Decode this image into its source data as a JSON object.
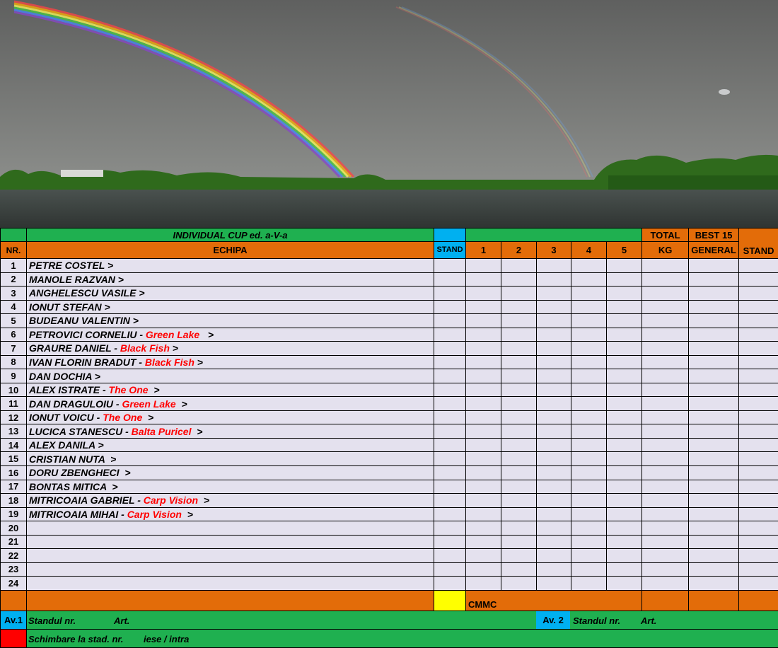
{
  "header": {
    "title": "INDIVIDUAL CUP ed. a-V-a",
    "col_nr": "NR.",
    "col_echipa": "ECHIPA",
    "col_stand": "STAND",
    "manches": [
      "1",
      "2",
      "3",
      "4",
      "5"
    ],
    "total_top": "TOTAL",
    "total_bottom": "KG",
    "best_top": "BEST 15",
    "best_bottom": "GENERAL",
    "stand_final": "STAND"
  },
  "rows": [
    {
      "nr": "1",
      "name": "PETRE COSTEL",
      "team": "",
      "arrow": " >"
    },
    {
      "nr": "2",
      "name": "MANOLE RAZVAN",
      "team": "",
      "arrow": " >"
    },
    {
      "nr": "3",
      "name": "ANGHELESCU VASILE",
      "team": "",
      "arrow": " >"
    },
    {
      "nr": "4",
      "name": "IONUT STEFAN",
      "team": "",
      "arrow": " >"
    },
    {
      "nr": "5",
      "name": "BUDEANU VALENTIN",
      "team": "",
      "arrow": " >"
    },
    {
      "nr": "6",
      "name": "PETROVICI CORNELIU - ",
      "team": "Green Lake",
      "arrow": "   >"
    },
    {
      "nr": "7",
      "name": "GRAURE DANIEL - ",
      "team": "Black Fish",
      "arrow": " >"
    },
    {
      "nr": "8",
      "name": "IVAN FLORIN BRADUT  - ",
      "team": "Black Fish",
      "arrow": " >"
    },
    {
      "nr": "9",
      "name": "DAN DOCHIA",
      "team": "",
      "arrow": " >"
    },
    {
      "nr": "10",
      "name": "ALEX ISTRATE - ",
      "team": "The One",
      "arrow": "  >"
    },
    {
      "nr": "11",
      "name": "DAN DRAGULOIU - ",
      "team": "Green Lake",
      "arrow": "  >"
    },
    {
      "nr": "12",
      "name": "IONUT VOICU - ",
      "team": "The One",
      "arrow": "  >"
    },
    {
      "nr": "13",
      "name": "LUCICA STANESCU - ",
      "team": "Balta Puricel",
      "arrow": "  >"
    },
    {
      "nr": "14",
      "name": "ALEX DANILA",
      "team": "",
      "arrow": " >"
    },
    {
      "nr": "15",
      "name": "CRISTIAN NUTA",
      "team": "",
      "arrow": "  >"
    },
    {
      "nr": "16",
      "name": "DORU ZBENGHECI",
      "team": "",
      "arrow": "  >"
    },
    {
      "nr": "17",
      "name": "BONTAS MITICA",
      "team": "",
      "arrow": "  >"
    },
    {
      "nr": "18",
      "name": "MITRICOAIA GABRIEL - ",
      "team": "Carp Vision",
      "arrow": "  >"
    },
    {
      "nr": "19",
      "name": "MITRICOAIA MIHAI - ",
      "team": "Carp Vision",
      "arrow": "  >"
    },
    {
      "nr": "20",
      "name": "",
      "team": "",
      "arrow": ""
    },
    {
      "nr": "21",
      "name": "",
      "team": "",
      "arrow": ""
    },
    {
      "nr": "22",
      "name": "",
      "team": "",
      "arrow": ""
    },
    {
      "nr": "23",
      "name": "",
      "team": "",
      "arrow": ""
    },
    {
      "nr": "24",
      "name": "",
      "team": "",
      "arrow": ""
    }
  ],
  "summary": {
    "label": "CMMC"
  },
  "footer": {
    "av1": "Av.1",
    "standul": "Standul nr.",
    "art1": "Art.",
    "av2": "Av. 2",
    "standul2": "Standul  nr.",
    "art2": "Art.",
    "schimbare": "Schimbare la stad.  nr.",
    "iese": "iese / intra"
  },
  "colors": {
    "green": "#1fb050",
    "orange": "#e36c09",
    "blue": "#00b0f0",
    "lavender": "#e4e1ee",
    "yellow": "#ffff00",
    "red": "#ff0000"
  }
}
